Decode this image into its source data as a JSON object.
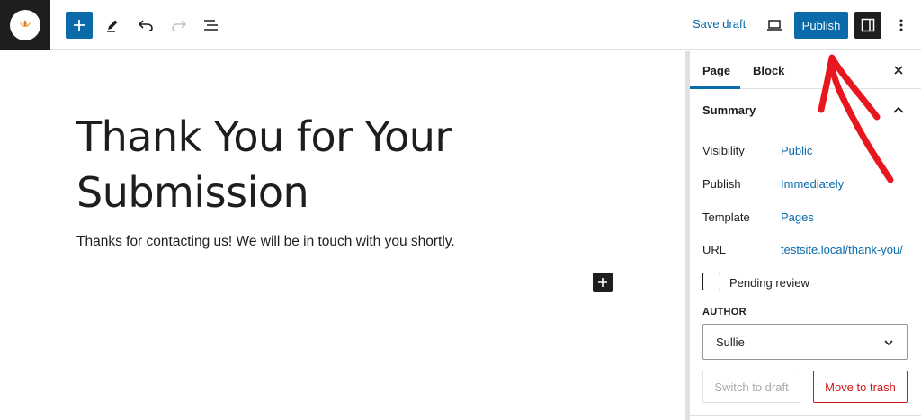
{
  "toolbar": {
    "save_draft": "Save draft",
    "publish": "Publish",
    "icons": [
      "site-logo",
      "plus-icon",
      "pencil-icon",
      "undo-icon",
      "redo-icon",
      "list-view-icon",
      "laptop-preview-icon",
      "sidebar-settings-icon",
      "more-vertical-icon"
    ],
    "accent_color": "#0a6aaa"
  },
  "editor": {
    "title": "Thank You for Your Submission",
    "paragraph": "Thanks for contacting us! We will be in touch with you shortly."
  },
  "sidebar": {
    "tabs": [
      {
        "label": "Page",
        "active": true
      },
      {
        "label": "Block",
        "active": false
      }
    ],
    "summary": {
      "heading": "Summary",
      "rows": [
        {
          "label": "Visibility",
          "value": "Public"
        },
        {
          "label": "Publish",
          "value": "Immediately"
        },
        {
          "label": "Template",
          "value": "Pages"
        },
        {
          "label": "URL",
          "value": "testsite.local/thank-you/"
        }
      ],
      "pending_review_label": "Pending review",
      "pending_review_checked": false,
      "author_label": "AUTHOR",
      "author_value": "Sullie",
      "switch_to_draft": "Switch to draft",
      "move_to_trash": "Move to trash"
    }
  },
  "annotation": {
    "color": "#e8171f",
    "shape": "arrow-pointing-up"
  }
}
